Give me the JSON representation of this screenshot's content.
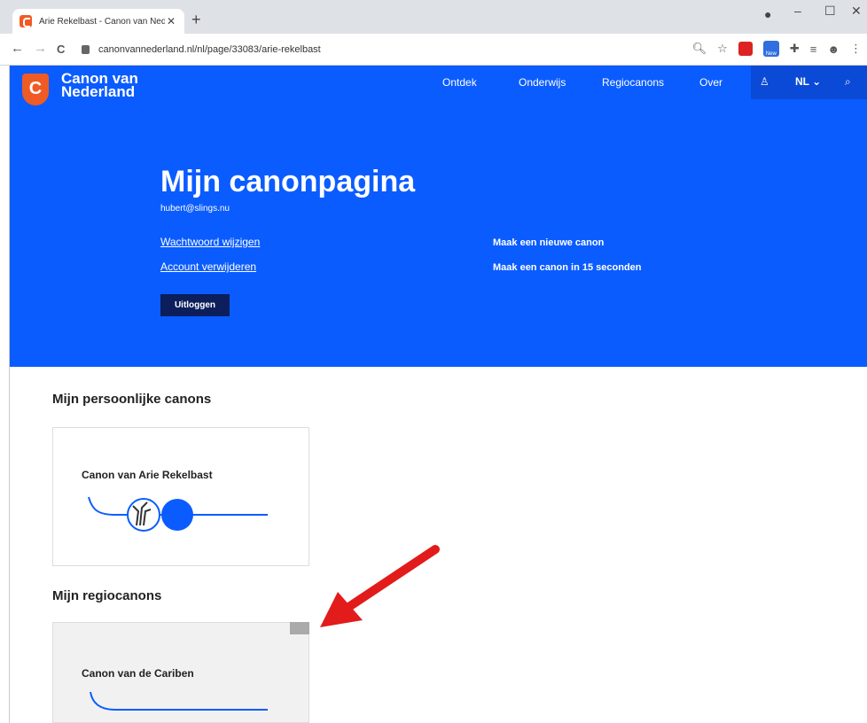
{
  "browser": {
    "tab_title": "Arie Rekelbast - Canon van Nede",
    "tab_close": "✕",
    "new_tab": "+",
    "url": "canonvannederland.nl/nl/page/33083/arie-rekelbast",
    "window": {
      "minimize": "–",
      "maximize": "☐",
      "close": "✕"
    },
    "nav": {
      "back": "←",
      "forward": "→",
      "reload": "C"
    }
  },
  "site": {
    "brand_line1": "Canon van",
    "brand_line2": "Nederland",
    "logo_letter": "C",
    "nav": [
      "Ontdek",
      "Onderwijs",
      "Regiocanons",
      "Over"
    ],
    "lang": "NL",
    "icons": {
      "account": "user-icon",
      "search": "search-icon",
      "chevron": "chevron-down-icon"
    }
  },
  "hero": {
    "title": "Mijn canonpagina",
    "email": "hubert@slings.nu",
    "change_password": "Wachtwoord wijzigen",
    "delete_account": "Account verwijderen",
    "new_canon": "Maak een nieuwe canon",
    "quick_canon": "Maak een canon in 15 seconden",
    "logout": "Uitloggen"
  },
  "sections": {
    "personal_title": "Mijn persoonlijke canons",
    "personal_card_title": "Canon van Arie Rekelbast",
    "regional_title": "Mijn regiocanons",
    "regional_card_title": "Canon van de Cariben"
  },
  "colors": {
    "hero_blue": "#0b5cff",
    "dark_navy": "#0c1f5c",
    "logo_orange": "#ef5b25",
    "arrow_red": "#e21b1b"
  }
}
